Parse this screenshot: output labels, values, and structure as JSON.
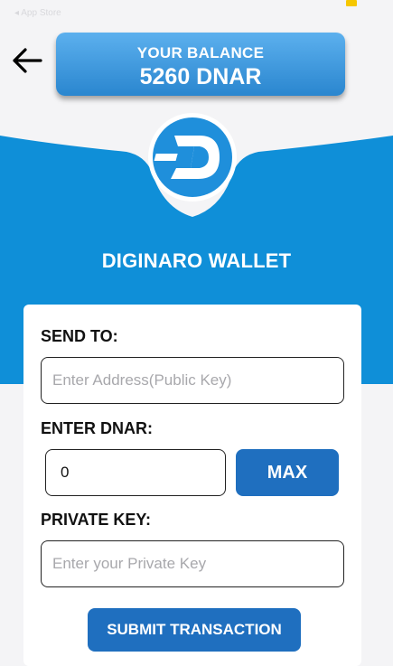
{
  "status": {
    "back_label": "◂ App Store"
  },
  "header": {
    "balance_label": "YOUR BALANCE",
    "balance_value": "5260 DNAR"
  },
  "wallet": {
    "title": "DIGINARO WALLET"
  },
  "form": {
    "send_to_label": "SEND TO:",
    "address_placeholder": "Enter Address(Public Key)",
    "amount_label": "ENTER DNAR:",
    "amount_value": "0",
    "max_label": "MAX",
    "private_key_label": "PRIVATE KEY:",
    "private_key_placeholder": "Enter your Private Key",
    "submit_label": "SUBMIT TRANSACTION"
  },
  "colors": {
    "accent": "#1f6fbf",
    "hero_blue": "#0f8fd8",
    "background": "#f4f4f6"
  },
  "icons": [
    "back-arrow-icon",
    "diginaro-logo-icon",
    "battery-icon"
  ]
}
